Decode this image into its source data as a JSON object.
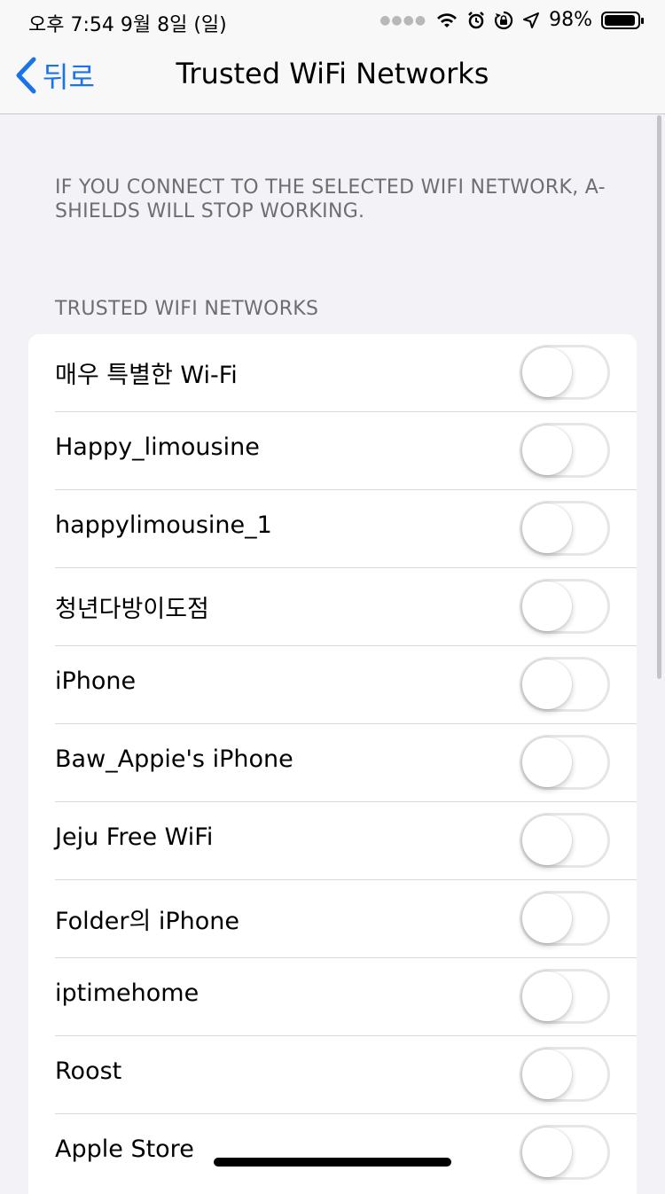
{
  "status_bar": {
    "time_date": "오후 7:54   9월 8일 (일)",
    "battery_percent": "98%",
    "icons": [
      "signal-dots-icon",
      "wifi-icon",
      "alarm-icon",
      "rotation-lock-icon",
      "location-icon",
      "battery-icon"
    ]
  },
  "nav": {
    "back_label": "뒤로",
    "title": "Trusted WiFi Networks"
  },
  "description": "IF YOU CONNECT TO THE SELECTED WIFI NETWORK, A-SHIELDS WILL STOP WORKING.",
  "section_header": "TRUSTED WIFI NETWORKS",
  "networks": [
    {
      "name": "매우 특별한 Wi-Fi",
      "enabled": false
    },
    {
      "name": "Happy_limousine",
      "enabled": false
    },
    {
      "name": "happylimousine_1",
      "enabled": false
    },
    {
      "name": "청년다방이도점",
      "enabled": false
    },
    {
      "name": "iPhone",
      "enabled": false
    },
    {
      "name": "Baw_Appie's iPhone",
      "enabled": false
    },
    {
      "name": "Jeju Free WiFi",
      "enabled": false
    },
    {
      "name": "Folder의 iPhone",
      "enabled": false
    },
    {
      "name": "iptimehome",
      "enabled": false
    },
    {
      "name": "Roost",
      "enabled": false
    },
    {
      "name": "Apple Store",
      "enabled": false
    }
  ],
  "colors": {
    "accent": "#1a73e8",
    "background": "#f2f2f7",
    "secondary_text": "#6d6d72"
  }
}
